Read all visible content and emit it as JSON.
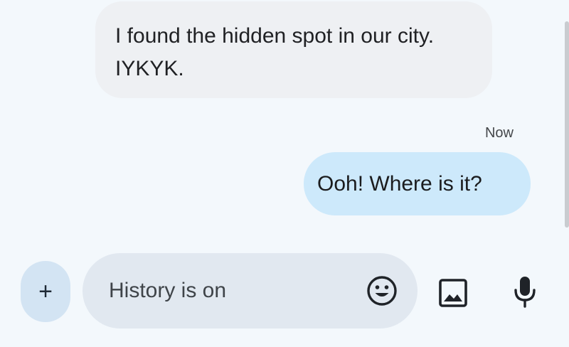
{
  "conversation": {
    "incoming_message": "I found the hidden spot in our city. IYKYK.",
    "timestamp": "Now",
    "outgoing_message": "Ooh! Where is it?"
  },
  "composer": {
    "add_label": "+",
    "placeholder": "History is on",
    "icons": {
      "add": "plus-icon",
      "emoji": "emoji-icon",
      "gallery": "image-icon",
      "mic": "microphone-icon"
    }
  },
  "colors": {
    "background": "#f3f8fc",
    "incoming_bubble": "#eef0f3",
    "outgoing_bubble": "#cde9fb",
    "compose_field": "#e1e8f0",
    "add_button": "#d3e4f3"
  }
}
